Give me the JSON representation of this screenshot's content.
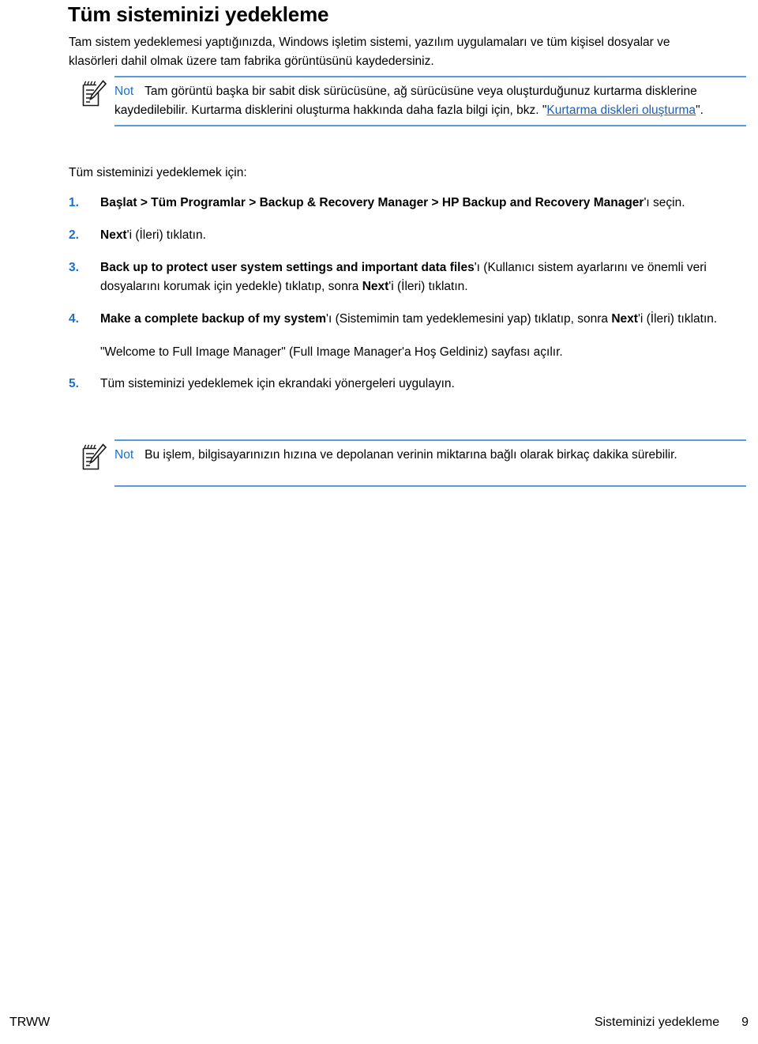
{
  "page": {
    "title": "Tüm sisteminizi yedekleme",
    "intro": "Tam sistem yedeklemesi yaptığınızda, Windows işletim sistemi, yazılım uygulamaları ve tüm kişisel dosyalar ve klasörleri dahil olmak üzere tam fabrika görüntüsünü kaydedersiniz.",
    "lead_in": "Tüm sisteminizi yedeklemek için:"
  },
  "notes": [
    {
      "label": "Not",
      "text_before_link": "Tam görüntü başka bir sabit disk sürücüsüne, ağ sürücüsüne veya oluşturduğunuz kurtarma disklerine kaydedilebilir. Kurtarma disklerini oluşturma hakkında daha fazla bilgi için, bkz. \"",
      "link": "Kurtarma diskleri oluşturma",
      "text_after_link": "\"."
    },
    {
      "label": "Not",
      "text": "Bu işlem, bilgisayarınızın hızına ve depolanan verinin miktarına bağlı olarak birkaç dakika sürebilir."
    }
  ],
  "steps": [
    {
      "num": "1.",
      "bold": "Başlat > Tüm Programlar > Backup & Recovery Manager > HP Backup and Recovery Manager",
      "rest": "'ı seçin."
    },
    {
      "num": "2.",
      "bold": "Next",
      "rest": "'i (İleri) tıklatın."
    },
    {
      "num": "3.",
      "bold": "Back up to protect user system settings and important data files",
      "mid": "'ı (Kullanıcı sistem ayarlarını ve önemli veri dosyalarını korumak için yedekle) tıklatıp, sonra ",
      "bold2": "Next",
      "rest": "'i (İleri) tıklatın."
    },
    {
      "num": "4.",
      "bold": "Make a complete backup of my system",
      "mid": "'ı (Sistemimin tam yedeklemesini yap) tıklatıp, sonra ",
      "bold2": "Next",
      "rest": "'i (İleri) tıklatın."
    },
    {
      "num": "5.",
      "bold": "",
      "rest": "Tüm sisteminizi yedeklemek için ekrandaki yönergeleri uygulayın."
    }
  ],
  "step_sub_note": "\"Welcome to Full Image Manager\" (Full Image Manager'a Hoş Geldiniz) sayfası açılır.",
  "footer": {
    "left": "TRWW",
    "section": "Sisteminizi yedekleme",
    "page_number": "9"
  },
  "colors": {
    "note_label": "#1c6fc4",
    "rule": "#5b9bd5",
    "link": "#1c5fb4",
    "step_number": "#1c6fc4"
  },
  "icons": {
    "note": "notepad-pencil-icon"
  }
}
